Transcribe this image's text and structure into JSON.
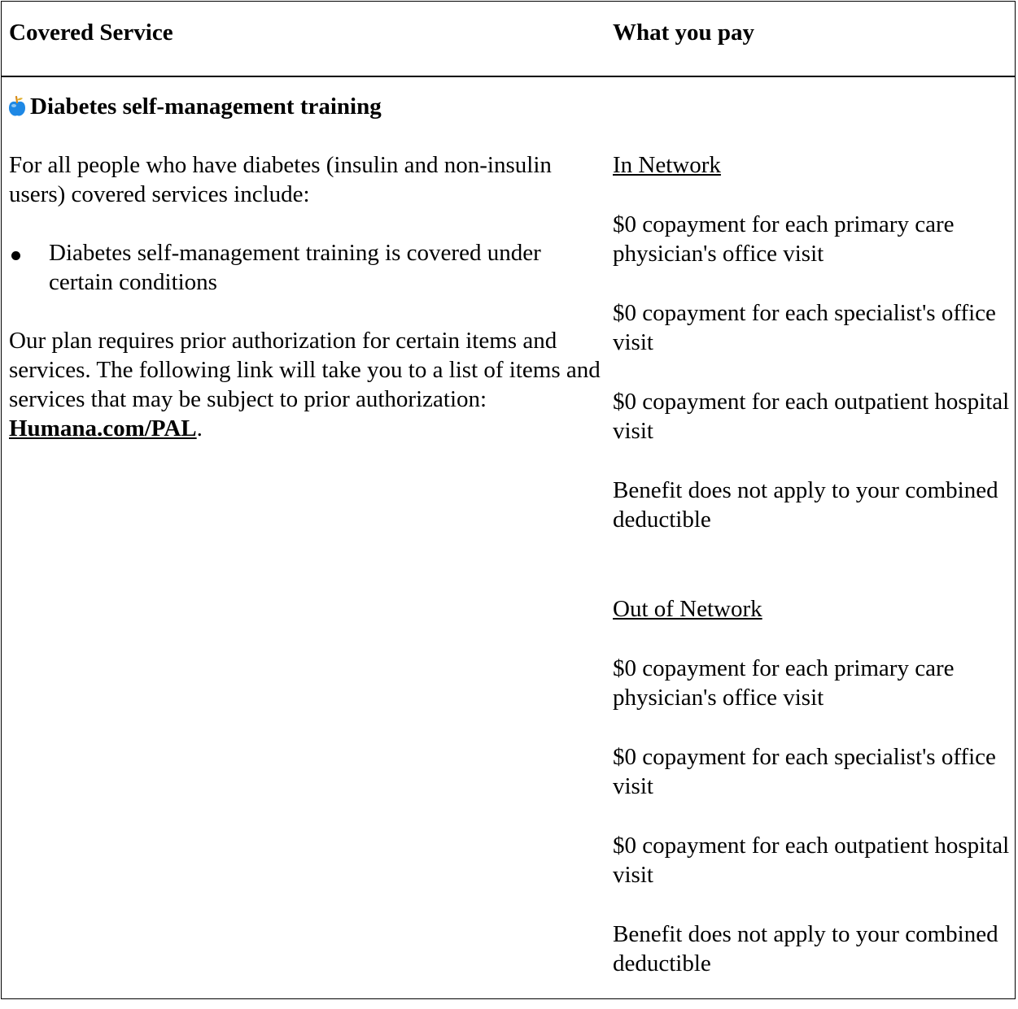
{
  "table": {
    "header": {
      "service": "Covered Service",
      "pay": "What you pay"
    },
    "service_title": "Diabetes self-management training",
    "service_icon": "apple-icon",
    "left": {
      "intro": "For all people who have diabetes (insulin and non-insulin users) covered services include:",
      "bullets": [
        "Diabetes self-management training is covered under certain conditions"
      ],
      "auth_text": "Our plan requires prior authorization for certain items and services. The following link will take you to a list of items and services that may be subject to prior authorization: ",
      "auth_link": "Humana.com/PAL",
      "auth_end": "."
    },
    "right": {
      "in_network": {
        "heading": "In Network",
        "items": [
          "$0 copayment for each primary care physician's office visit",
          "$0 copayment for each specialist's office visit",
          "$0 copayment for each outpatient hospital visit",
          "Benefit does not apply to your combined deductible"
        ]
      },
      "out_network": {
        "heading": "Out of Network",
        "items": [
          "$0 copayment for each primary care physician's office visit",
          "$0 copayment for each specialist's office visit",
          "$0 copayment for each outpatient hospital visit",
          "Benefit does not apply to your combined deductible"
        ]
      }
    }
  },
  "colors": {
    "text": "#000000",
    "icon_blue": "#1e88e5",
    "icon_stem": "#d98b1a"
  }
}
